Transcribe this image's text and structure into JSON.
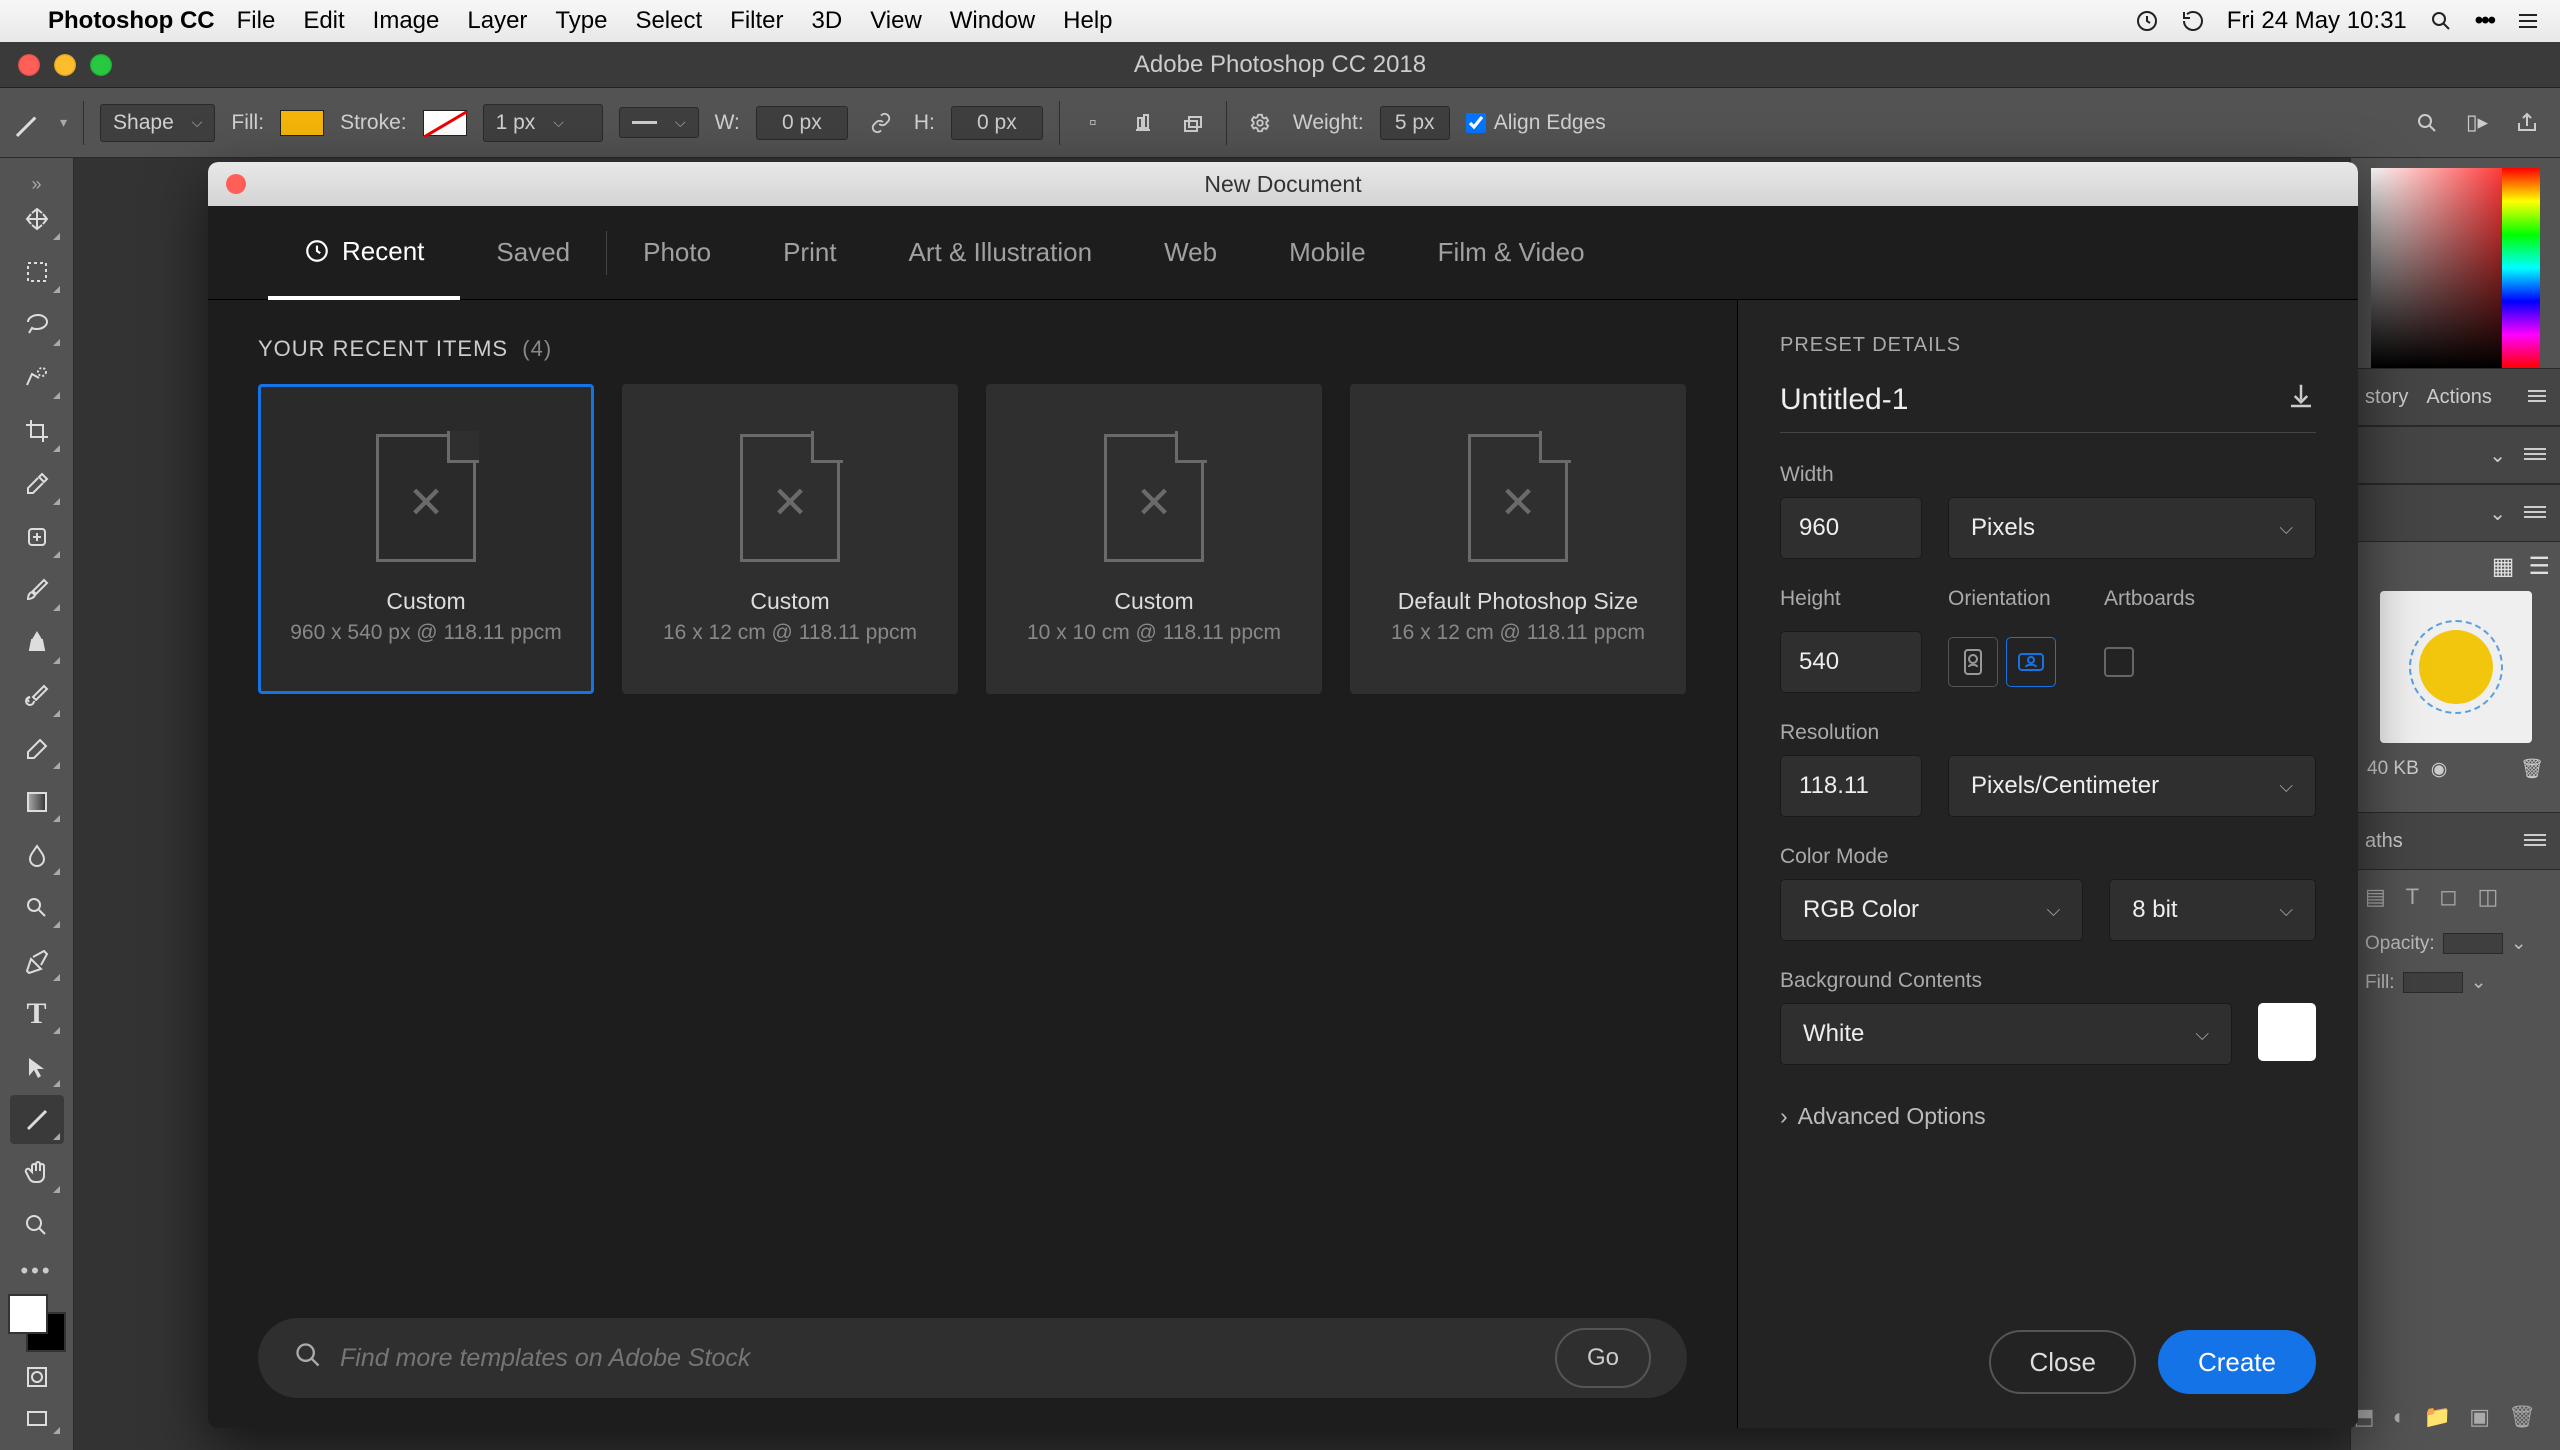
{
  "macos": {
    "app_name": "Photoshop CC",
    "menus": [
      "File",
      "Edit",
      "Image",
      "Layer",
      "Type",
      "Select",
      "Filter",
      "3D",
      "View",
      "Window",
      "Help"
    ],
    "date_time": "Fri 24 May  10:31"
  },
  "window": {
    "title": "Adobe Photoshop CC 2018"
  },
  "options_bar": {
    "shape_dropdown": "Shape",
    "fill_label": "Fill:",
    "stroke_label": "Stroke:",
    "stroke_width": "1 px",
    "w_label": "W:",
    "w_value": "0 px",
    "h_label": "H:",
    "h_value": "0 px",
    "weight_label": "Weight:",
    "weight_value": "5 px",
    "align_edges_label": "Align Edges"
  },
  "right_dock": {
    "history_label": "story",
    "actions_label": "Actions",
    "brush_size": "40 KB",
    "paths_label": "aths",
    "opacity_label": "Opacity:",
    "fill_label": "Fill:"
  },
  "modal": {
    "title": "New Document",
    "tabs": [
      "Recent",
      "Saved",
      "Photo",
      "Print",
      "Art & Illustration",
      "Web",
      "Mobile",
      "Film & Video"
    ],
    "recent_heading": "YOUR RECENT ITEMS",
    "recent_count": "(4)",
    "presets": [
      {
        "name": "Custom",
        "desc": "960 x 540 px @ 118.11 ppcm"
      },
      {
        "name": "Custom",
        "desc": "16 x 12 cm @ 118.11 ppcm"
      },
      {
        "name": "Custom",
        "desc": "10 x 10 cm @ 118.11 ppcm"
      },
      {
        "name": "Default Photoshop Size",
        "desc": "16 x 12 cm @ 118.11 ppcm"
      }
    ],
    "search_placeholder": "Find more templates on Adobe Stock",
    "go_label": "Go",
    "details": {
      "title": "PRESET DETAILS",
      "doc_name": "Untitled-1",
      "width_label": "Width",
      "width_value": "960",
      "width_unit": "Pixels",
      "height_label": "Height",
      "height_value": "540",
      "orient_label": "Orientation",
      "artboards_label": "Artboards",
      "res_label": "Resolution",
      "res_value": "118.11",
      "res_unit": "Pixels/Centimeter",
      "colormode_label": "Color Mode",
      "colormode_value": "RGB Color",
      "bitdepth_value": "8 bit",
      "bg_label": "Background Contents",
      "bg_value": "White",
      "advanced_label": "Advanced Options",
      "close_label": "Close",
      "create_label": "Create"
    }
  }
}
